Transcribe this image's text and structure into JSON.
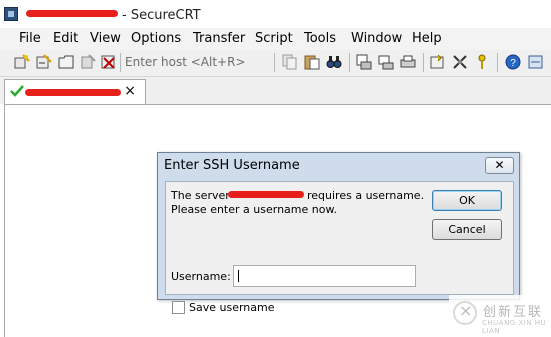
{
  "window": {
    "title_suffix": "- SecureCRT"
  },
  "menu": [
    {
      "label": "File"
    },
    {
      "label": "Edit"
    },
    {
      "label": "View"
    },
    {
      "label": "Options"
    },
    {
      "label": "Transfer"
    },
    {
      "label": "Script"
    },
    {
      "label": "Tools"
    },
    {
      "label": "Window"
    },
    {
      "label": "Help"
    }
  ],
  "toolbar": {
    "host_placeholder": "Enter host <Alt+R>",
    "icons": [
      "connect-icon",
      "quick-connect-icon",
      "connect-in-tab-icon",
      "reconnect-icon",
      "disconnect-icon",
      "copy-icon",
      "paste-icon",
      "find-icon",
      "print-setup-icon",
      "print-screen-icon",
      "print-icon",
      "session-options-icon",
      "global-options-icon",
      "keymap-icon",
      "help-icon",
      "extra-icon"
    ]
  },
  "tab": {
    "close_glyph": "×",
    "status": "connected"
  },
  "dialog": {
    "title": "Enter SSH Username",
    "close_glyph": "✕",
    "message_start": "The server",
    "message_end": "requires a username.",
    "message_line2": "Please enter a username now.",
    "username_label": "Username:",
    "username_value": "",
    "ok_label": "OK",
    "cancel_label": "Cancel",
    "save_label": "Save username",
    "save_checked": false
  },
  "watermark": {
    "text_cn": "创新互联",
    "text_en": "CHUANG XIN HU LIAN"
  }
}
